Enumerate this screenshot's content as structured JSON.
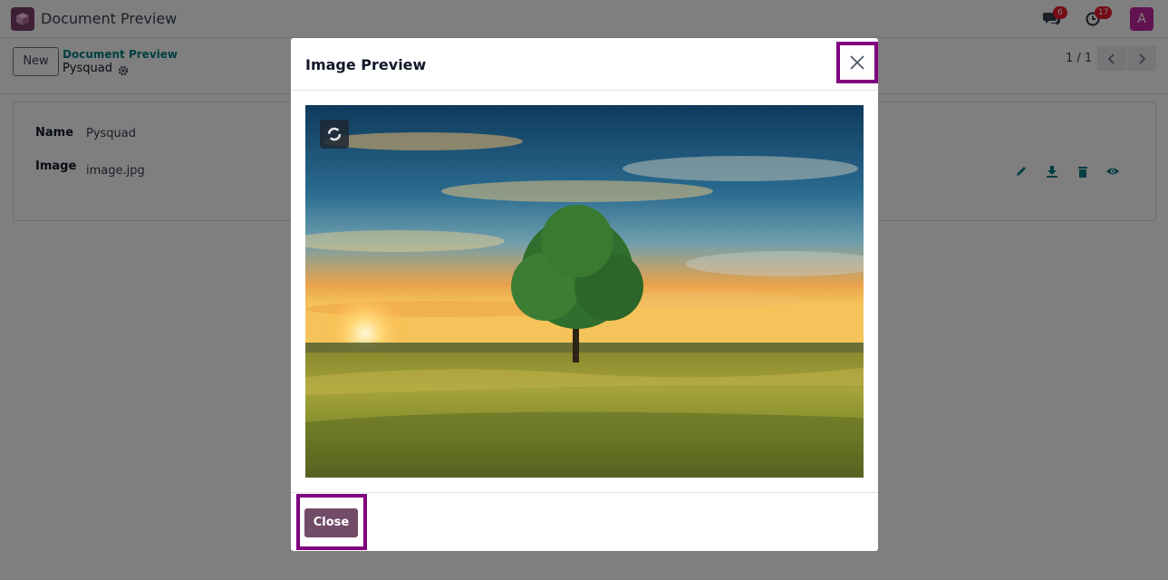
{
  "navbar": {
    "app_title": "Document Preview",
    "logo_icon": "cube-icon",
    "messages_icon": "chat-icon",
    "messages_count": "6",
    "activities_icon": "clock-icon",
    "activities_count": "17",
    "avatar_letter": "A",
    "avatar_color": "#c026a0",
    "logo_color": "#7c3e6c"
  },
  "control_panel": {
    "new_label": "New",
    "breadcrumb_parent": "Document Preview",
    "breadcrumb_current": "Pysquad",
    "pager_value": "1 / 1",
    "accent_color": "#017e84"
  },
  "form": {
    "name_label": "Name",
    "name_value": "Pysquad",
    "image_label": "Image",
    "image_value": "image.jpg",
    "actions": [
      "pencil-icon",
      "download-icon",
      "trash-icon",
      "eye-icon"
    ]
  },
  "modal": {
    "title": "Image Preview",
    "close_button_label": "Close",
    "primary_color": "#714b67",
    "highlight_color": "#800080",
    "image_subject": "tree-in-field-at-sunset"
  }
}
